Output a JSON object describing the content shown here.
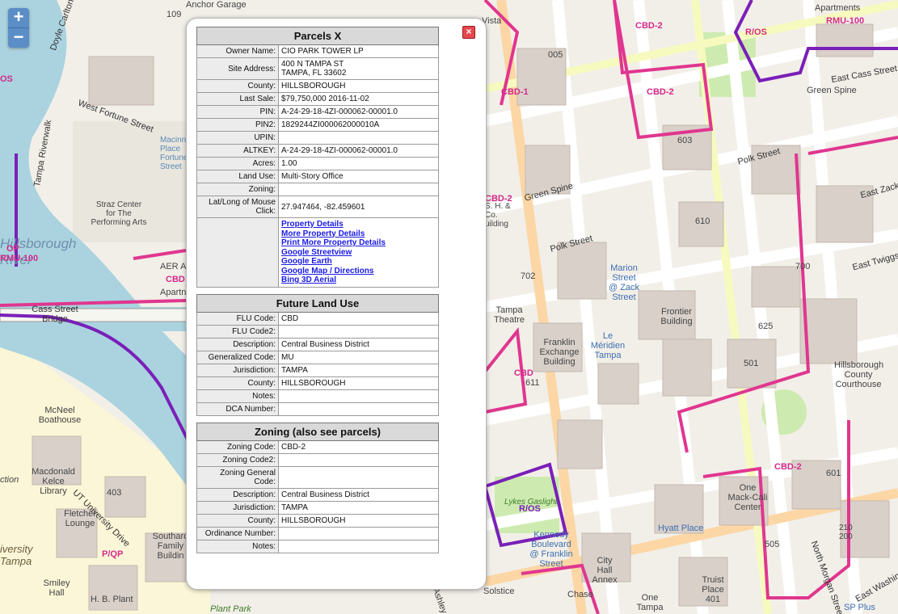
{
  "zoom": {
    "in_label": "+",
    "out_label": "−"
  },
  "map_labels": {
    "anchor_garage": "Anchor Garage",
    "vista": "Vista",
    "apartments": "Apartments",
    "rmu100_top": "RMU-100",
    "ros_top": "R/OS",
    "cbd2_a": "CBD-2",
    "cbd1": "CBD-1",
    "cbd2_b": "CBD-2",
    "east_cass": "East Cass Street",
    "green_spine_top": "Green Spine",
    "doyle": "Doyle Carlton Drive",
    "west_fortune": "West Fortune Street",
    "tampa_riverwalk": "Tampa Riverwalk",
    "macinnes": "Macinnes Place Fortune Street",
    "straz": "Straz Center for The Performing Arts",
    "hillsborough_river": "Hillsborough River",
    "op": "OP",
    "rmu100_left": "RMU-100",
    "ros_left": "OS",
    "aer": "AER Apartme",
    "apart": "Apartn",
    "cbd_left": "CBD",
    "cass_bridge": "Cass Street Bridge",
    "mcneel": "McNeel Boathouse",
    "macdonald": "Macdonald Kelce Library",
    "ut_drive": "UT University Drive",
    "n403": "403",
    "fletcher": "Fletcher Lounge",
    "southard": "Southard Family Buildin",
    "pqp": "P/QP",
    "iversity": "iversity Tampa",
    "smiley": "Smiley Hall",
    "hb_plant": "H. B. Plant",
    "plant_park": "Plant Park",
    "ction": "ction",
    "n603": "603",
    "polk_east": "Polk Street",
    "east_zack": "East Zack",
    "green_spine_mid": "Green Spine",
    "n610": "610",
    "polk_west": "Polk Street",
    "cbd2_mid": "CBD-2",
    "marion": "Marion Street @ Zack Street",
    "n700": "700",
    "east_twiggs": "East Twiggs",
    "n702": "702",
    "tampa_theatre": "Tampa Theatre",
    "frontier": "Frontier Building",
    "franklin_exchange": "Franklin Exchange Building",
    "le_meridien": "Le Méridien Tampa",
    "n625": "625",
    "n501": "501",
    "courthouse": "Hillsborough County Courthouse",
    "cbd_611": "CBD",
    "n611": "611",
    "cbd2_right": "CBD-2",
    "n601": "601",
    "one_mack": "One Mack-Cali Center",
    "ros_bottom": "R/OS",
    "lykes": "Lykes Gaslight",
    "kennedy": "Kennedy Boulevard @ Franklin Street",
    "hyatt": "Hyatt Place",
    "n505": "505",
    "city_hall": "City Hall Annex",
    "chase": "Chase",
    "solstice": "Solstice",
    "truist": "Truist Place 401",
    "one_tampa": "One Tampa",
    "north_morgan": "North Morgan Street",
    "east_washington": "East Washington",
    "sp_plus": "SP Plus",
    "n210": "210 200",
    "ashley": "Ashley",
    "n005": "005",
    "n109": "109",
    "h_s": "S. H. & Co. uilding"
  },
  "popup": {
    "close_icon_label": "×",
    "parcels": {
      "title": "Parcels X",
      "rows": [
        {
          "label": "Owner Name:",
          "value": "CIO PARK TOWER LP"
        },
        {
          "label": "Site Address:",
          "value": "400 N TAMPA ST\nTAMPA, FL 33602"
        },
        {
          "label": "County:",
          "value": "HILLSBOROUGH"
        },
        {
          "label": "Last Sale:",
          "value": "$79,750,000  2016-11-02"
        },
        {
          "label": "PIN:",
          "value": "A-24-29-18-4ZI-000062-00001.0"
        },
        {
          "label": "PIN2:",
          "value": "1829244ZI000062000010A"
        },
        {
          "label": "UPIN:",
          "value": ""
        },
        {
          "label": "ALTKEY:",
          "value": "A-24-29-18-4ZI-000062-00001.0"
        },
        {
          "label": "Acres:",
          "value": "1.00"
        },
        {
          "label": "Land Use:",
          "value": "Multi-Story Office"
        },
        {
          "label": "Zoning:",
          "value": ""
        },
        {
          "label": "Lat/Long of Mouse Click:",
          "value": "27.947464, -82.459601"
        }
      ],
      "links": [
        "Property Details",
        "More Property Details",
        "Print More Property Details",
        "Google Streetview",
        "Google Earth",
        "Google Map / Directions",
        "Bing 3D Aerial"
      ]
    },
    "flu": {
      "title": "Future Land Use",
      "rows": [
        {
          "label": "FLU Code:",
          "value": "CBD"
        },
        {
          "label": "FLU Code2:",
          "value": ""
        },
        {
          "label": "Description:",
          "value": "Central Business District"
        },
        {
          "label": "Generalized Code:",
          "value": "MU"
        },
        {
          "label": "Jurisdiction:",
          "value": "TAMPA"
        },
        {
          "label": "County:",
          "value": "HILLSBOROUGH"
        },
        {
          "label": "Notes:",
          "value": ""
        },
        {
          "label": "DCA Number:",
          "value": ""
        }
      ]
    },
    "zoning": {
      "title": "Zoning (also see parcels)",
      "rows": [
        {
          "label": "Zoning Code:",
          "value": "CBD-2"
        },
        {
          "label": "Zoning Code2:",
          "value": ""
        },
        {
          "label": "Zoning General Code:",
          "value": ""
        },
        {
          "label": "Description:",
          "value": "Central Business District"
        },
        {
          "label": "Jurisdiction:",
          "value": "TAMPA"
        },
        {
          "label": "County:",
          "value": "HILLSBOROUGH"
        },
        {
          "label": "Ordinance Number:",
          "value": ""
        },
        {
          "label": "Notes:",
          "value": ""
        }
      ]
    }
  }
}
